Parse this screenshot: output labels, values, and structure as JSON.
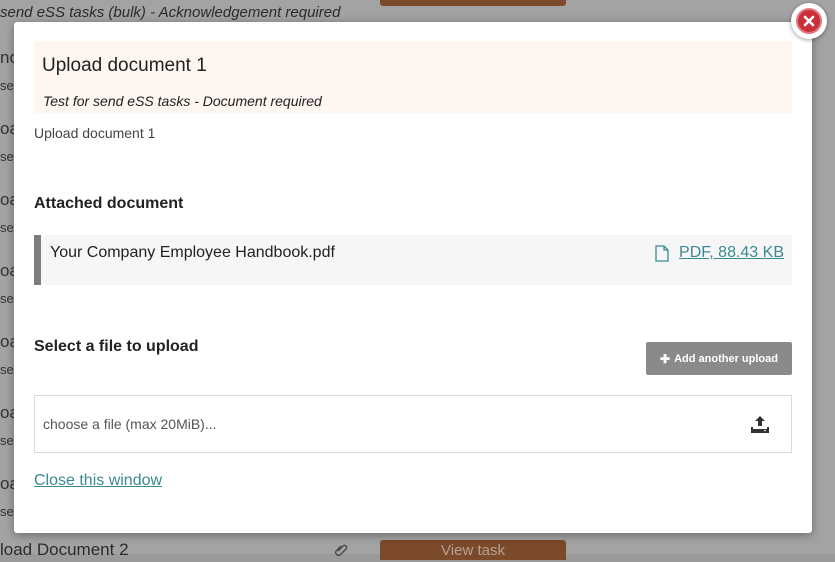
{
  "background": {
    "top_task_title": "send eSS tasks (bulk) - Acknowledgement required",
    "fragments": [
      "no",
      "se",
      "oa",
      "se",
      "oa",
      "se",
      "oa",
      "se",
      "oa",
      "se",
      "oa",
      "se",
      "oa",
      "se",
      "oa",
      "se"
    ],
    "bottom_task_title": "load Document 2",
    "bottom_button_label": "View task"
  },
  "modal": {
    "task_title": "Upload document 1",
    "task_subtitle": "Test for send eSS tasks - Document required",
    "description": "Upload document 1",
    "attached_heading": "Attached document",
    "attached_document": {
      "name": "Your Company Employee Handbook.pdf",
      "link_label": "PDF, 88.43 KB",
      "icon": "file-icon"
    },
    "select_heading": "Select a file to upload",
    "add_upload_label": "Add another upload",
    "file_input": {
      "placeholder": "choose a file (max 20MiB)...",
      "icon": "upload-icon"
    },
    "close_link_label": "Close this window",
    "close_icon": "close-icon"
  },
  "colors": {
    "accent_link": "#3a8a92",
    "header_bg": "#fdf6f1",
    "close_red": "#c9303a",
    "button_gray": "#8a8a8a",
    "bg_button_brown": "#7b4a2a"
  }
}
